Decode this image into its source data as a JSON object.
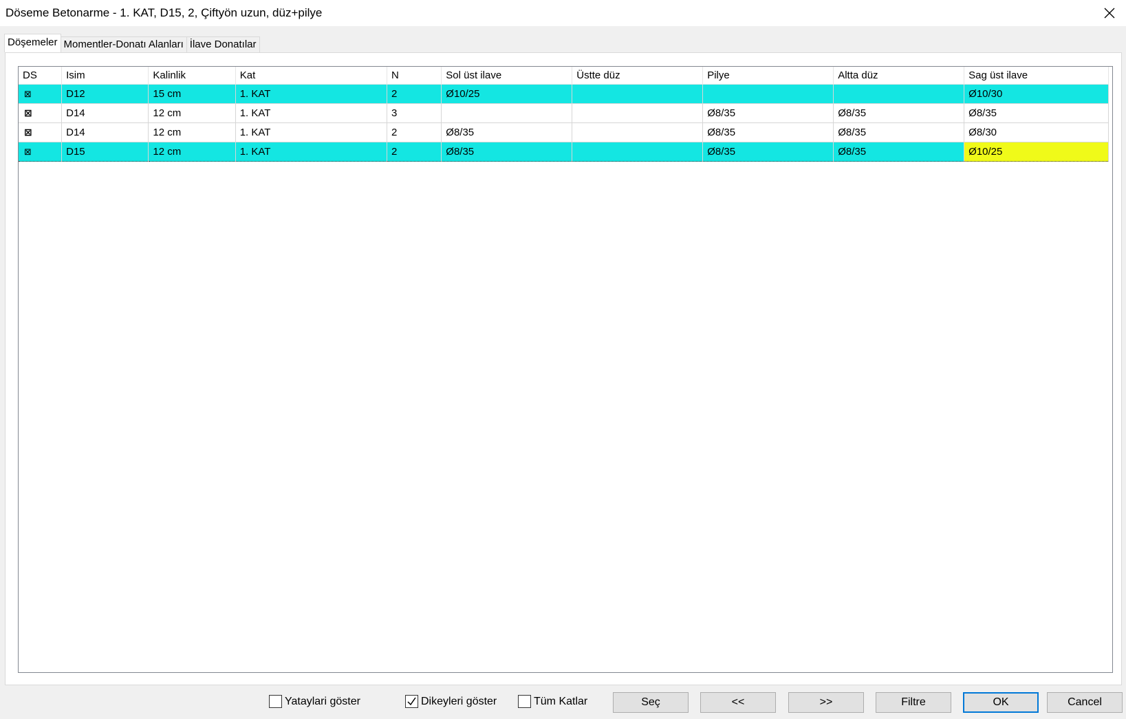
{
  "window": {
    "title": "Döseme Betonarme - 1. KAT, D15, 2, Çiftyön uzun, düz+pilye",
    "close_icon": "close-icon"
  },
  "tabs": [
    {
      "label": "Döşemeler",
      "active": true
    },
    {
      "label": "Momentler-Donatı Alanları",
      "active": false
    },
    {
      "label": "İlave Donatılar",
      "active": false
    }
  ],
  "grid": {
    "columns": [
      "DS",
      "Isim",
      "Kalinlik",
      "Kat",
      "N",
      "Sol üst ilave",
      "Üstte düz",
      "Pilye",
      "Altta düz",
      "Sag üst ilave"
    ],
    "rows": [
      {
        "ds": "⊠",
        "isim": "D12",
        "kalinlik": "15 cm",
        "kat": "1. KAT",
        "n": "2",
        "sol_ust_ilave": "Ø10/25",
        "ustte_duz": "",
        "pilye": "",
        "altta_duz": "",
        "sag_ust_ilave": "Ø10/30",
        "highlight": true
      },
      {
        "ds": "⊠",
        "isim": "D14",
        "kalinlik": "12 cm",
        "kat": "1. KAT",
        "n": "3",
        "sol_ust_ilave": "",
        "ustte_duz": "",
        "pilye": "Ø8/35",
        "altta_duz": "Ø8/35",
        "sag_ust_ilave": "Ø8/35",
        "highlight": false
      },
      {
        "ds": "⊠",
        "isim": "D14",
        "kalinlik": "12 cm",
        "kat": "1. KAT",
        "n": "2",
        "sol_ust_ilave": "Ø8/35",
        "ustte_duz": "",
        "pilye": "Ø8/35",
        "altta_duz": "Ø8/35",
        "sag_ust_ilave": "Ø8/30",
        "highlight": false
      },
      {
        "ds": "⊠",
        "isim": "D15",
        "kalinlik": "12 cm",
        "kat": "1. KAT",
        "n": "2",
        "sol_ust_ilave": "Ø8/35",
        "ustte_duz": "",
        "pilye": "Ø8/35",
        "altta_duz": "Ø8/35",
        "sag_ust_ilave": "Ø10/25",
        "highlight": true
      }
    ]
  },
  "options": {
    "yataylari": {
      "label": "Yataylari göster",
      "checked": false
    },
    "dikeyleri": {
      "label": "Dikeyleri göster",
      "checked": true
    },
    "tum_katlar": {
      "label": "Tüm Katlar",
      "checked": false
    }
  },
  "buttons": {
    "sec": "Seç",
    "prev": "<<",
    "next": ">>",
    "filtre": "Filtre",
    "ok": "OK",
    "cancel": "Cancel"
  },
  "colors": {
    "row_highlight": "#14e6e2",
    "cell_highlight": "#f0fa19",
    "default_button_border": "#0078d7"
  }
}
